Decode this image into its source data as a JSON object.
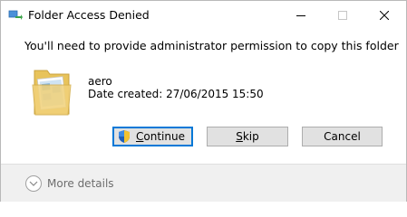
{
  "window": {
    "title": "Folder Access Denied",
    "title_icon": "file-copy-icon",
    "controls": {
      "minimize": "minimize-icon",
      "maximize": "maximize-icon",
      "close": "close-icon"
    }
  },
  "dialog": {
    "heading": "You'll need to provide administrator permission to copy this folder",
    "item": {
      "icon": "folder-icon",
      "name": "aero",
      "date_created": "Date created: 27/06/2015 15:50"
    },
    "buttons": {
      "continue": {
        "prefix": "",
        "underlined": "C",
        "rest": "ontinue",
        "icon": "uac-shield-icon"
      },
      "skip": {
        "underlined": "S",
        "rest": "kip"
      },
      "cancel": {
        "label": "Cancel"
      }
    },
    "more_details": {
      "label": "More details",
      "icon": "chevron-down-icon"
    }
  },
  "colors": {
    "accent": "#0078d7",
    "button_bg": "#e1e1e1",
    "footer_bg": "#f0f0f0",
    "muted_text": "#6d6d6d"
  }
}
